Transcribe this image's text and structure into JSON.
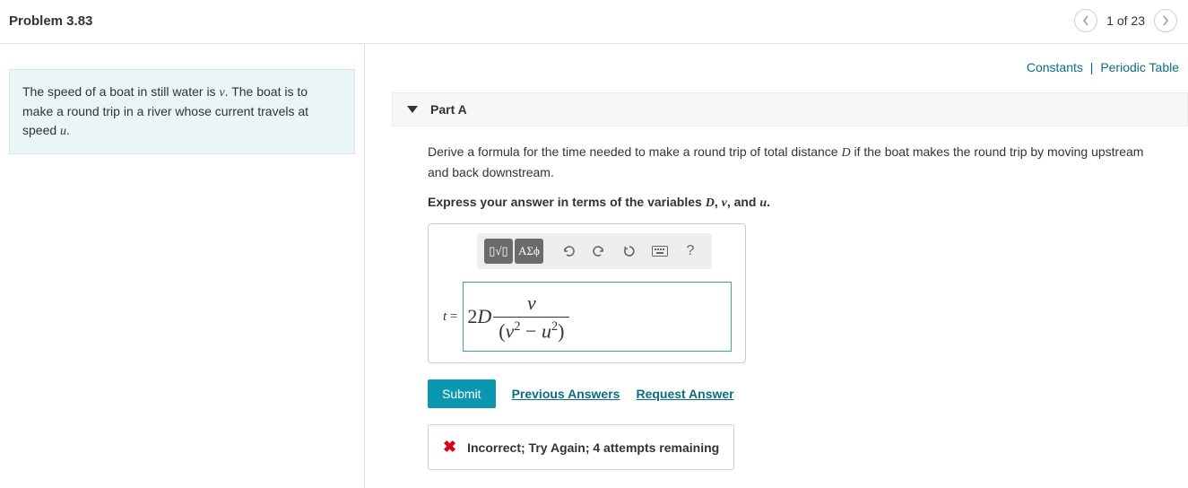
{
  "header": {
    "title": "Problem 3.83",
    "pager_text": "1 of 23"
  },
  "top_links": {
    "constants": "Constants",
    "periodic": "Periodic Table"
  },
  "problem_statement": {
    "pre": "The speed of a boat in still water is ",
    "v": "v",
    "mid": ". The boat is to make a round trip in a river whose current travels at speed ",
    "u": "u",
    "post": "."
  },
  "part": {
    "label": "Part A",
    "question_pre": "Derive a formula for the time needed to make a round trip of total distance ",
    "D": "D",
    "question_post": " if the boat makes the round trip by moving upstream and back downstream.",
    "instruct_pre": "Express your answer in terms of the variables ",
    "inst_D": "D",
    "inst_sep1": ", ",
    "inst_v": "v",
    "inst_sep2": ", and ",
    "inst_u": "u",
    "instruct_post": "."
  },
  "toolbar": {
    "templates": "▯√▯",
    "greek": "ΑΣϕ"
  },
  "answer": {
    "lhs": "t",
    "eq": " = ",
    "coef": "2",
    "D": "D",
    "num": "v",
    "den_open": "(",
    "den_v": "v",
    "den_minus": " − ",
    "den_u": "u",
    "den_close": ")"
  },
  "actions": {
    "submit": "Submit",
    "previous": "Previous Answers",
    "request": "Request Answer"
  },
  "feedback": {
    "text": "Incorrect; Try Again; 4 attempts remaining"
  }
}
